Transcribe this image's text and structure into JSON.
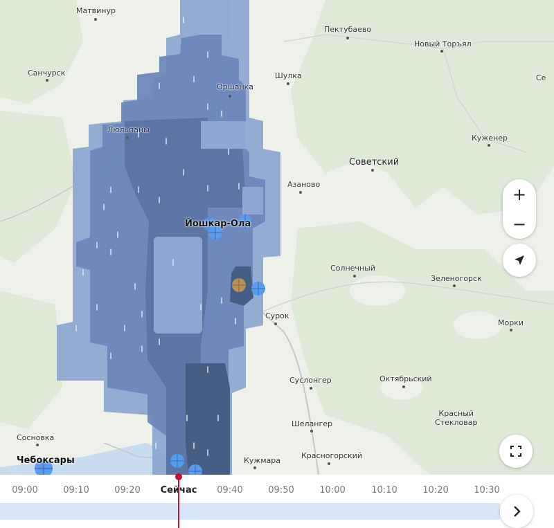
{
  "map": {
    "places": [
      {
        "id": "matvinur",
        "name": "Матвинур",
        "cls": ""
      },
      {
        "id": "pektubaevo",
        "name": "Пектубаево",
        "cls": ""
      },
      {
        "id": "noviy-toryal",
        "name": "Новый Торъял",
        "cls": ""
      },
      {
        "id": "sanchursk",
        "name": "Санчурск",
        "cls": ""
      },
      {
        "id": "shulka",
        "name": "Шулка",
        "cls": ""
      },
      {
        "id": "orshanka",
        "name": "Оршанка",
        "cls": ""
      },
      {
        "id": "se",
        "name": "Се",
        "cls": ""
      },
      {
        "id": "lyupshpaly",
        "name": "Люльпаны",
        "cls": ""
      },
      {
        "id": "kuzhener",
        "name": "Куженер",
        "cls": ""
      },
      {
        "id": "sovetskiy",
        "name": "Советский",
        "cls": "big"
      },
      {
        "id": "azanovo",
        "name": "Азаново",
        "cls": ""
      },
      {
        "id": "yoshkar-ola",
        "name": "Йошкар-Ола",
        "cls": "bold"
      },
      {
        "id": "solnechny",
        "name": "Солнечный",
        "cls": ""
      },
      {
        "id": "zelenogorsk",
        "name": "Зеленогорск",
        "cls": ""
      },
      {
        "id": "surok",
        "name": "Сурок",
        "cls": ""
      },
      {
        "id": "morki",
        "name": "Морки",
        "cls": ""
      },
      {
        "id": "suslonger",
        "name": "Суслонгер",
        "cls": ""
      },
      {
        "id": "oktyabrskiy",
        "name": "Октябрьский",
        "cls": ""
      },
      {
        "id": "krasny-steklovar",
        "name": "Красный\nСтекловар",
        "cls": ""
      },
      {
        "id": "shelanger",
        "name": "Шелангер",
        "cls": ""
      },
      {
        "id": "sosnovka",
        "name": "Сосновка",
        "cls": ""
      },
      {
        "id": "cheboksary",
        "name": "Чебоксары",
        "cls": "bold"
      },
      {
        "id": "kuzhmara",
        "name": "Кужмара",
        "cls": ""
      },
      {
        "id": "krasnogorskiy",
        "name": "Красногорский",
        "cls": ""
      }
    ],
    "controls": {
      "zoom_in": "+",
      "zoom_out": "−",
      "locate_icon": "navigation-arrow-icon",
      "fullscreen_icon": "fullscreen-icon"
    },
    "colors": {
      "base": "#eef0ea",
      "forest": "#dfe9d8",
      "water": "#c9dcef",
      "rain_light": "#8ea6d1",
      "rain_medium": "#6d87bb",
      "rain_heavy": "#58719f",
      "rain_very_heavy": "#475e84"
    }
  },
  "timeline": {
    "ticks": [
      "09:00",
      "09:10",
      "09:20",
      "Сейчас",
      "09:40",
      "09:50",
      "10:00",
      "10:10",
      "10:20",
      "10:30"
    ],
    "current_index": 3,
    "next_icon": "chevron-right-icon"
  }
}
